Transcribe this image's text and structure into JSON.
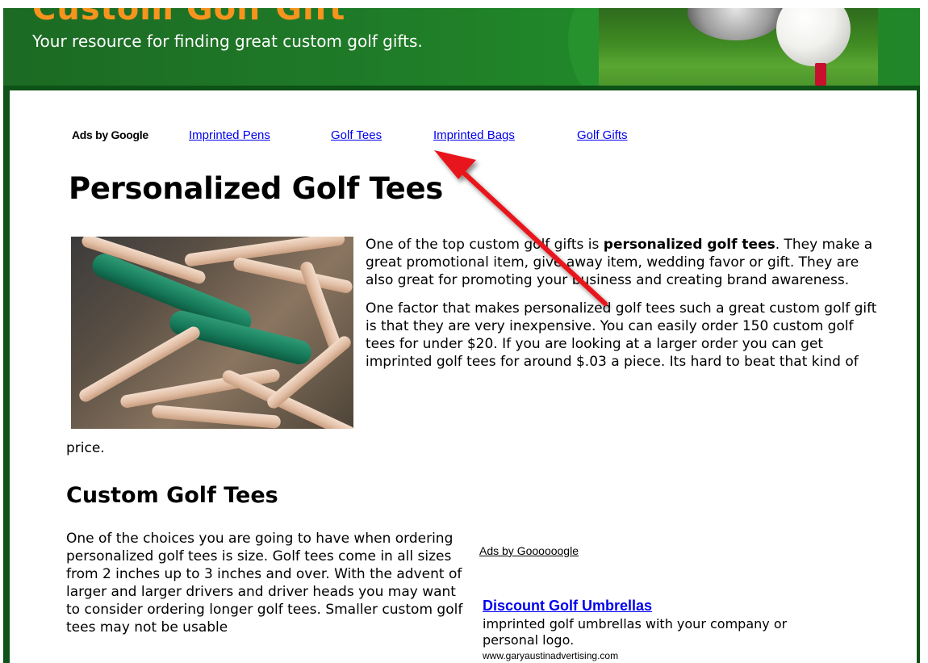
{
  "header": {
    "site_title": "Custom Golf Gift",
    "tagline": "Your resource for finding great custom golf gifts."
  },
  "ads_bar": {
    "label": "Ads by Google",
    "links": [
      "Imprinted Pens",
      "Golf Tees",
      "Imprinted Bags",
      "Golf Gifts"
    ]
  },
  "article": {
    "title": "Personalized Golf Tees",
    "intro": {
      "p1_before": "One of the top custom golf gifts is ",
      "p1_bold": "personalized golf tees",
      "p1_after": ".  They make a great promotional item, give away item, wedding favor or gift.  They are also great for promoting your business and creating brand awareness.",
      "p2": "One factor that makes personalized golf tees such a great custom golf gift is that they are very inexpensive.  You can easily order 150 custom golf tees for under $20.  If you are looking at a larger order you can get imprinted golf tees for around $.03 a piece.  Its hard to beat that kind of",
      "p2_wrap": "price."
    },
    "section_heading": "Custom Golf Tees",
    "section_text": "One of the choices you are going to have when ordering personalized golf tees is size. Golf tees come in all sizes from 2 inches up to 3 inches and over.  With the advent of larger and larger drivers and driver heads you may want to consider ordering longer golf tees. Smaller custom golf tees may not be usable"
  },
  "ad_block": {
    "label": "Ads by Goooooogle",
    "ad_title": "Discount Golf Umbrellas",
    "ad_desc": "imprinted golf umbrellas with your company or personal logo.",
    "ad_url": "www.garyaustinadvertising.com"
  },
  "colors": {
    "header_green": "#1f7d28",
    "border_green": "#0d5216",
    "title_orange": "#f7941d",
    "link_blue": "#0000ee",
    "arrow_red": "#e8141a"
  }
}
